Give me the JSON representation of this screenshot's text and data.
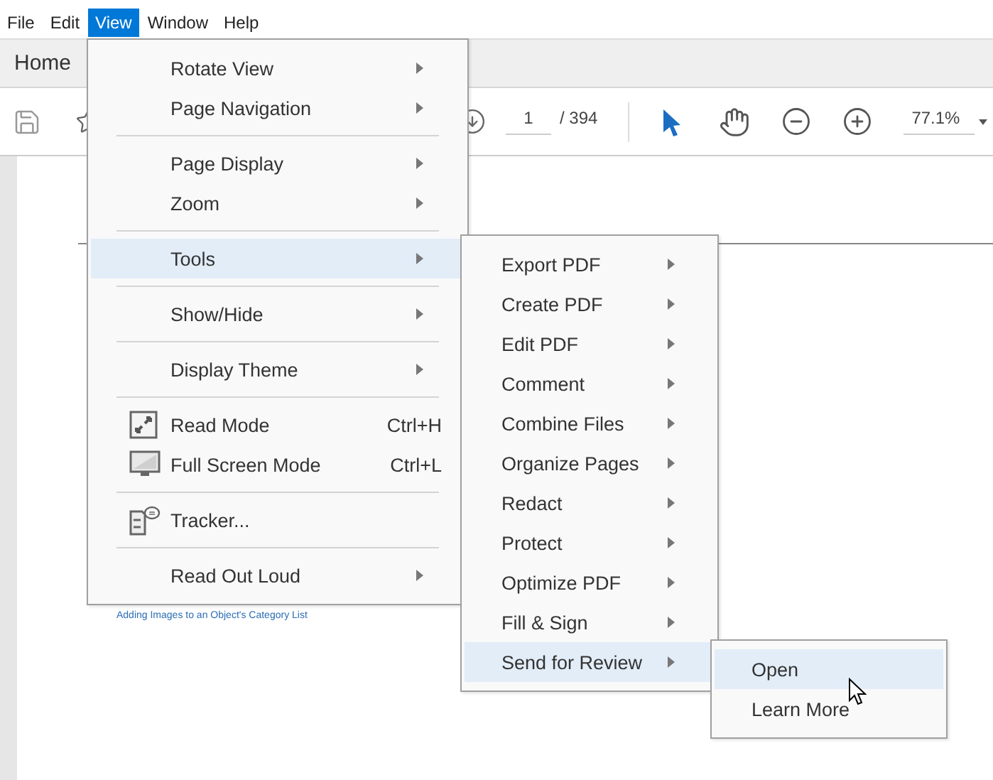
{
  "menubar": [
    {
      "label": "File",
      "selected": false
    },
    {
      "label": "Edit",
      "selected": false
    },
    {
      "label": "View",
      "selected": true
    },
    {
      "label": "Window",
      "selected": false
    },
    {
      "label": "Help",
      "selected": false
    }
  ],
  "tab": "Home",
  "toolbar": {
    "page_number": "1",
    "page_count": "/ 394",
    "zoom": "77.1%"
  },
  "document": {
    "link": "Adding Images to an Object's Category List"
  },
  "view_menu": {
    "items": [
      {
        "kind": "submenu",
        "label": "Rotate View",
        "selected": false
      },
      {
        "kind": "submenu",
        "label": "Page Navigation",
        "selected": false
      },
      {
        "kind": "separator"
      },
      {
        "kind": "submenu",
        "label": "Page Display",
        "selected": false
      },
      {
        "kind": "submenu",
        "label": "Zoom",
        "selected": false
      },
      {
        "kind": "separator"
      },
      {
        "kind": "submenu",
        "label": "Tools",
        "selected": true
      },
      {
        "kind": "separator"
      },
      {
        "kind": "submenu",
        "label": "Show/Hide",
        "selected": false
      },
      {
        "kind": "separator"
      },
      {
        "kind": "submenu",
        "label": "Display Theme",
        "selected": false
      },
      {
        "kind": "separator"
      },
      {
        "kind": "command",
        "label": "Read Mode",
        "selected": false,
        "shortcut": "Ctrl+H"
      },
      {
        "kind": "command",
        "label": "Full Screen Mode",
        "selected": false,
        "shortcut": "Ctrl+L"
      },
      {
        "kind": "separator"
      },
      {
        "kind": "command",
        "label": "Tracker...",
        "selected": false
      },
      {
        "kind": "separator"
      },
      {
        "kind": "submenu",
        "label": "Read Out Loud",
        "selected": false
      }
    ]
  },
  "tools_submenu": {
    "items": [
      {
        "kind": "submenu",
        "label": "Export PDF",
        "selected": false
      },
      {
        "kind": "submenu",
        "label": "Create PDF",
        "selected": false
      },
      {
        "kind": "submenu",
        "label": "Edit PDF",
        "selected": false
      },
      {
        "kind": "submenu",
        "label": "Comment",
        "selected": false
      },
      {
        "kind": "submenu",
        "label": "Combine Files",
        "selected": false
      },
      {
        "kind": "submenu",
        "label": "Organize Pages",
        "selected": false
      },
      {
        "kind": "submenu",
        "label": "Redact",
        "selected": false
      },
      {
        "kind": "submenu",
        "label": "Protect",
        "selected": false
      },
      {
        "kind": "submenu",
        "label": "Optimize PDF",
        "selected": false
      },
      {
        "kind": "submenu",
        "label": "Fill & Sign",
        "selected": false
      },
      {
        "kind": "submenu",
        "label": "Send for Review",
        "selected": true
      }
    ]
  },
  "review_submenu": {
    "items": [
      {
        "kind": "command",
        "label": "Open",
        "selected": true
      },
      {
        "kind": "command",
        "label": "Learn More",
        "selected": false
      }
    ]
  }
}
